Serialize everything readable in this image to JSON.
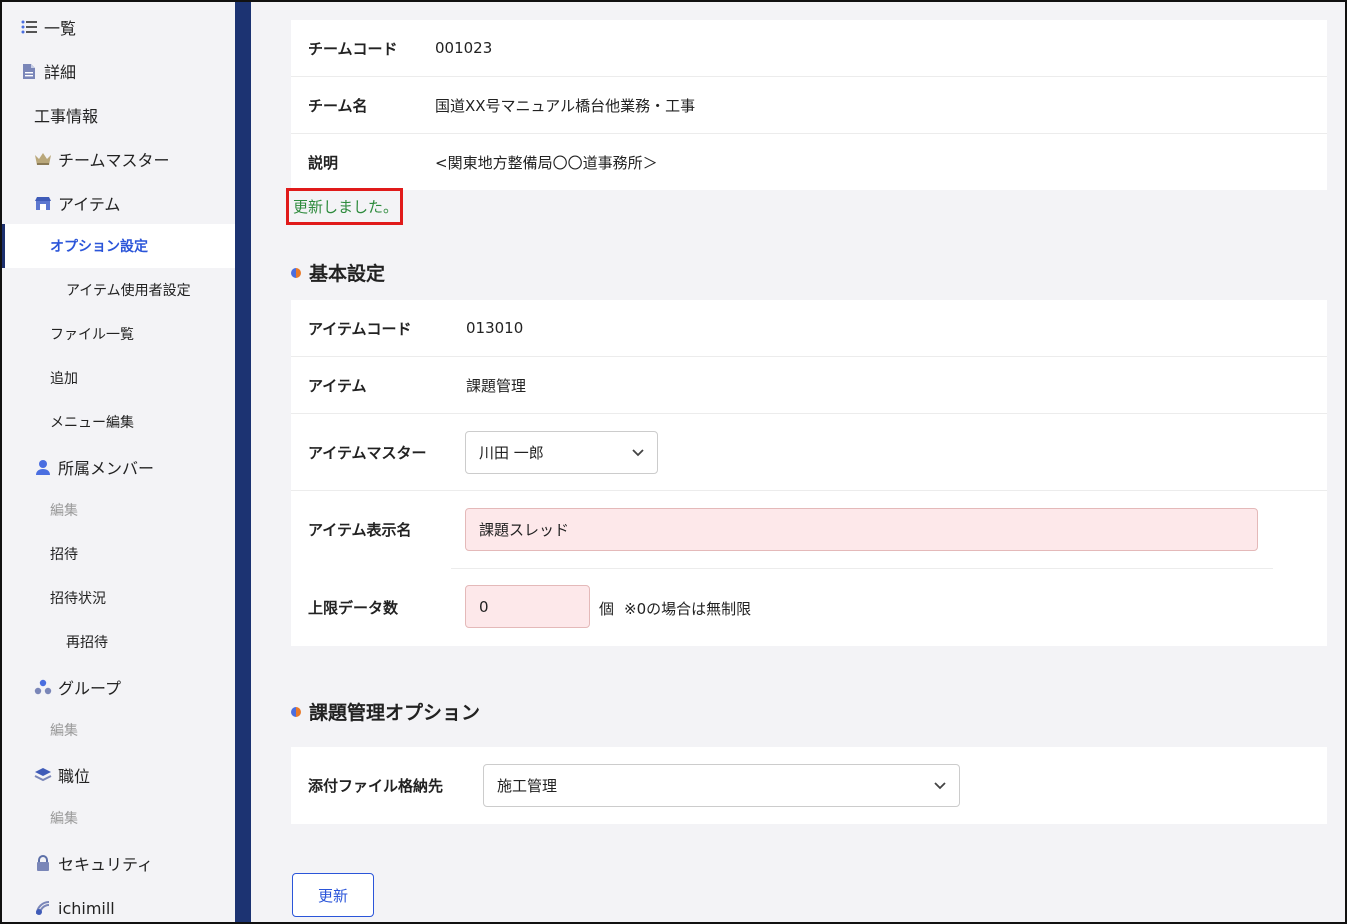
{
  "sidebar": {
    "items": [
      {
        "label": "一覧",
        "icon": "list-icon"
      },
      {
        "label": "詳細",
        "icon": "document-icon"
      },
      {
        "label": "工事情報"
      },
      {
        "label": "チームマスター",
        "icon": "crown-icon"
      },
      {
        "label": "アイテム",
        "icon": "store-icon"
      },
      {
        "label": "オプション設定"
      },
      {
        "label": "アイテム使用者設定"
      },
      {
        "label": "ファイル一覧"
      },
      {
        "label": "追加"
      },
      {
        "label": "メニュー編集"
      },
      {
        "label": "所属メンバー",
        "icon": "user-icon"
      },
      {
        "label": "編集"
      },
      {
        "label": "招待"
      },
      {
        "label": "招待状況"
      },
      {
        "label": "再招待"
      },
      {
        "label": "グループ",
        "icon": "group-icon"
      },
      {
        "label": "編集"
      },
      {
        "label": "職位",
        "icon": "layers-icon"
      },
      {
        "label": "編集"
      },
      {
        "label": "セキュリティ",
        "icon": "lock-icon"
      },
      {
        "label": "ichimill",
        "icon": "ichimill-icon"
      }
    ]
  },
  "team": {
    "code_label": "チームコード",
    "code_value": "001023",
    "name_label": "チーム名",
    "name_value": "国道XX号マニュアル橋台他業務・工事",
    "desc_label": "説明",
    "desc_value": "<関東地方整備局〇〇道事務所＞"
  },
  "status_message": "更新しました。",
  "basic": {
    "title": "基本設定",
    "item_code_label": "アイテムコード",
    "item_code_value": "013010",
    "item_label": "アイテム",
    "item_value": "課題管理",
    "master_label": "アイテムマスター",
    "master_value": "川田 一郎",
    "display_name_label": "アイテム表示名",
    "display_name_value": "課題スレッド",
    "limit_label": "上限データ数",
    "limit_value": "0",
    "limit_unit": "個",
    "limit_note": "※0の場合は無制限"
  },
  "option": {
    "title": "課題管理オプション",
    "folder_label": "添付ファイル格納先",
    "folder_value": "施工管理"
  },
  "submit_label": "更新",
  "colors": {
    "accent": "#2b55d9",
    "sidebar_bar": "#1c3372",
    "success": "#2e8b3d",
    "highlight_border": "#e01a1a",
    "input_error_bg": "#fde8ea"
  }
}
